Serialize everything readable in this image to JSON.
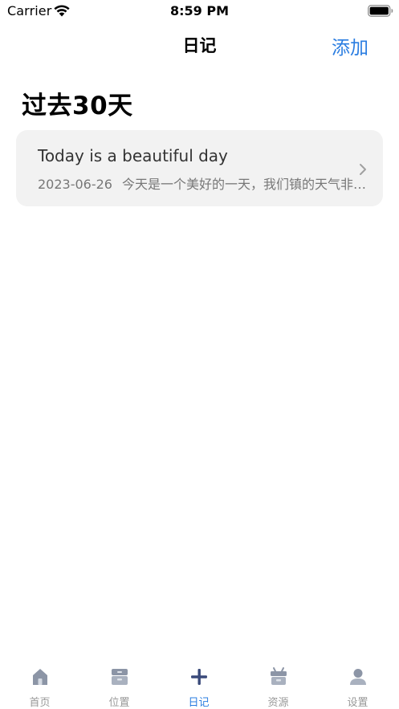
{
  "status_bar": {
    "carrier": "Carrier",
    "time": "8:59 PM"
  },
  "nav": {
    "title": "日记",
    "add_label": "添加"
  },
  "section": {
    "title": "过去30天"
  },
  "entries": [
    {
      "title": "Today is a beautiful day",
      "date": "2023-06-26",
      "preview": "今天是一个美好的一天，我们镇的天气非常好"
    }
  ],
  "tabs": [
    {
      "label": "首页",
      "icon": "home-icon"
    },
    {
      "label": "位置",
      "icon": "location-box-icon"
    },
    {
      "label": "日记",
      "icon": "plus-icon",
      "active": true
    },
    {
      "label": "资源",
      "icon": "resource-box-icon"
    },
    {
      "label": "设置",
      "icon": "person-icon"
    }
  ],
  "colors": {
    "accent": "#2a7de1",
    "card_bg": "#f2f2f2",
    "tab_inactive": "#999999"
  }
}
